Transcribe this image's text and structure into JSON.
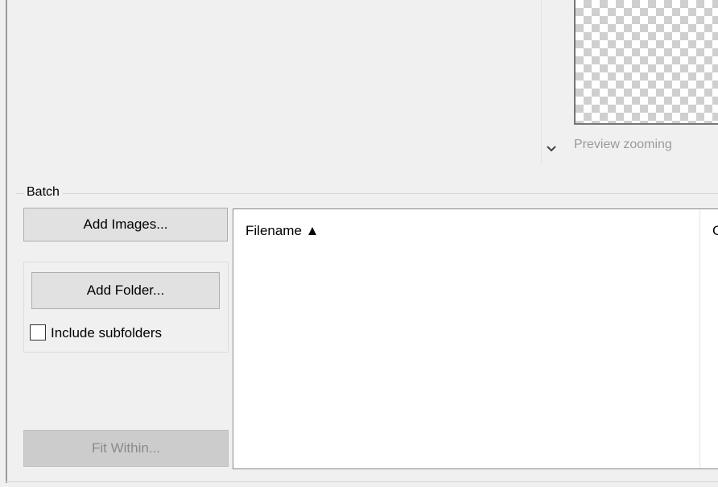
{
  "preview": {
    "zooming_label": "Preview zooming",
    "chevron_icon": "chevron-down-icon"
  },
  "batch": {
    "group_label": "Batch",
    "add_images_label": "Add Images...",
    "add_folder_label": "Add Folder...",
    "include_subfolders_label": "Include subfolders",
    "include_subfolders_checked": false,
    "fit_within_label": "Fit Within...",
    "file_list": {
      "columns": [
        "Filename ▲",
        "C"
      ],
      "rows": []
    }
  },
  "colors": {
    "window_bg": "#f0f0f0",
    "button_bg": "#e1e1e1",
    "button_border": "#adadad",
    "disabled_text": "#8a8a8a",
    "preview_label": "#9b9b9b"
  }
}
